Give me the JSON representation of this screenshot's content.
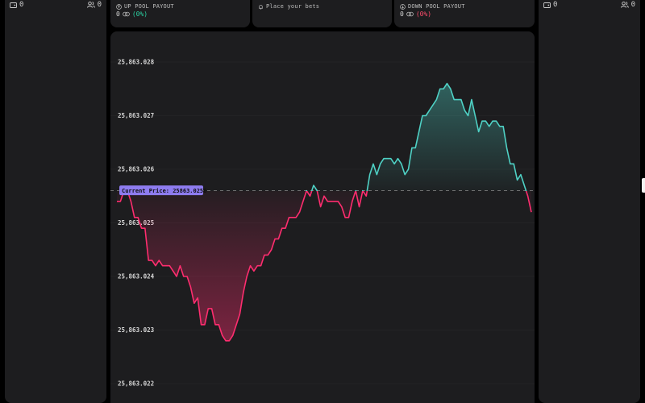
{
  "left_panel": {
    "wallet_count": "0",
    "users_count": "0"
  },
  "right_panel": {
    "wallet_count": "0",
    "users_count": "0"
  },
  "up_pool": {
    "title": "UP POOL PAYOUT",
    "amount": "0",
    "percent": "(0%)"
  },
  "bets": {
    "title": "Place your bets"
  },
  "down_pool": {
    "title": "DOWN POOL PAYOUT",
    "amount": "0",
    "percent": "(0%)"
  },
  "colors": {
    "up": "#4fd1c5",
    "down": "#ff2d6f",
    "badge": "#8e7cf0",
    "panel": "#1d1d1f"
  },
  "chart_data": {
    "type": "line",
    "baseline": 25863.0256,
    "current_price_label": "Current Price: 25863.0256",
    "ylim": [
      25863.0218,
      25863.0285
    ],
    "y_ticks": [
      25863.028,
      25863.027,
      25863.026,
      25863.025,
      25863.024,
      25863.023,
      25863.022
    ],
    "y_tick_labels": [
      "25,863.028",
      "25,863.027",
      "25,863.026",
      "25,863.025",
      "25,863.024",
      "25,863.023",
      "25,863.022"
    ],
    "values": [
      25863.0254,
      25863.0254,
      25863.0256,
      25863.0256,
      25863.0254,
      25863.0251,
      25863.0251,
      25863.0249,
      25863.0249,
      25863.0243,
      25863.0243,
      25863.0242,
      25863.0243,
      25863.0242,
      25863.0242,
      25863.0242,
      25863.0241,
      25863.024,
      25863.0242,
      25863.024,
      25863.024,
      25863.0238,
      25863.0235,
      25863.0236,
      25863.0231,
      25863.0231,
      25863.0234,
      25863.0234,
      25863.0231,
      25863.0231,
      25863.0229,
      25863.0228,
      25863.0228,
      25863.0229,
      25863.0231,
      25863.0233,
      25863.0237,
      25863.024,
      25863.0242,
      25863.0241,
      25863.0242,
      25863.0242,
      25863.0244,
      25863.0244,
      25863.0245,
      25863.0247,
      25863.0247,
      25863.0249,
      25863.0249,
      25863.0251,
      25863.0251,
      25863.0251,
      25863.0252,
      25863.0254,
      25863.0256,
      25863.0255,
      25863.0257,
      25863.0256,
      25863.0253,
      25863.0255,
      25863.0254,
      25863.0254,
      25863.0254,
      25863.0254,
      25863.0253,
      25863.0251,
      25863.0251,
      25863.0254,
      25863.0256,
      25863.0253,
      25863.0256,
      25863.0255,
      25863.0259,
      25863.0261,
      25863.0259,
      25863.0261,
      25863.0262,
      25863.0262,
      25863.0262,
      25863.0261,
      25863.0262,
      25863.0261,
      25863.0259,
      25863.026,
      25863.0264,
      25863.0264,
      25863.0267,
      25863.027,
      25863.027,
      25863.0271,
      25863.0272,
      25863.0273,
      25863.0275,
      25863.0275,
      25863.0276,
      25863.0275,
      25863.0273,
      25863.0273,
      25863.0273,
      25863.0271,
      25863.027,
      25863.0273,
      25863.027,
      25863.0267,
      25863.0269,
      25863.0269,
      25863.0268,
      25863.0269,
      25863.0269,
      25863.0268,
      25863.0268,
      25863.0264,
      25863.0261,
      25863.0261,
      25863.0258,
      25863.0259,
      25863.0257,
      25863.0255,
      25863.0252
    ]
  }
}
